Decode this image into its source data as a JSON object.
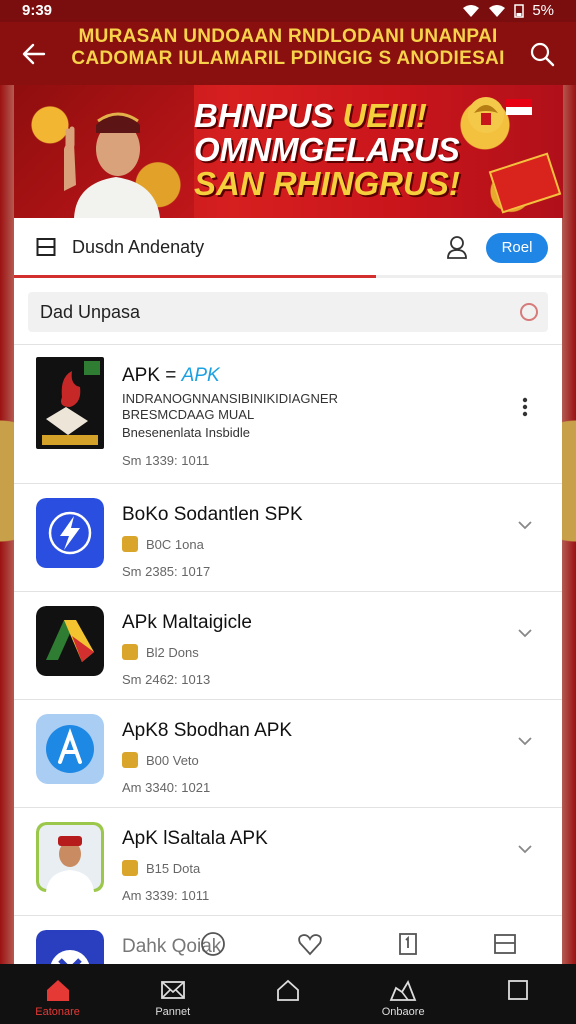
{
  "status_bar": {
    "time": "9:39",
    "battery": "5%",
    "icons": [
      "wifi-icon",
      "signal-icon",
      "battery-icon"
    ]
  },
  "app_bar": {
    "title_line1": "MURASAN UNDOAAN RNDLODANI UNANPAI",
    "title_line2": "CADOMAR IULAMARIL PDINGIG S ANODIESAI",
    "back_icon": "back-arrow-icon",
    "search_icon": "search-icon"
  },
  "banner": {
    "line1_white": "BHNPUS ",
    "line1_yellow": "UEIII!",
    "line2": "OMNMGELARUS",
    "line3": "SAN RHINGRUS!"
  },
  "toolbar": {
    "label": "Dusdn Andenaty",
    "button": "Roel",
    "progress_fraction": 0.66
  },
  "search": {
    "value": "Dad Unpasa"
  },
  "apps": [
    {
      "name_prefix": "APK = ",
      "name_accent": "APK",
      "desc1": "INDRANOGNNANSIBINIKIDIAGNER",
      "desc2": "BRESMCDAAG MUAL",
      "desc3": "Bnesenenlata Insbidle",
      "meta": "Sm 1339: 1011",
      "action": "kebab"
    },
    {
      "name": "BoKo Sodantlen SPK",
      "rating": "B0C 1ona",
      "meta": "Sm 2385: 1017",
      "action": "chevron"
    },
    {
      "name": "APk Maltaigicle",
      "rating": "Bl2 Dons",
      "meta": "Sm 2462: 1013",
      "action": "chevron"
    },
    {
      "name": "ApK8 Sbodhan APK",
      "rating": "B00 Veto",
      "meta": "Am 3340: 1021",
      "action": "chevron"
    },
    {
      "name": "ApK lSaltala APK",
      "rating": "B15 Dota",
      "meta": "Am 3339: 1011",
      "action": "chevron"
    },
    {
      "name": "Dahk Qoiak",
      "partial": true
    }
  ],
  "bottom_nav": [
    {
      "label": "Eatonare",
      "icon": "home-icon",
      "active": true
    },
    {
      "label": "Pannet",
      "icon": "envelope-icon",
      "active": false
    },
    {
      "label": "",
      "icon": "house-outline-icon",
      "active": false
    },
    {
      "label": "Onbaore",
      "icon": "share-icon",
      "active": false
    },
    {
      "label": "",
      "icon": "square-icon",
      "active": false
    }
  ],
  "colors": {
    "appbar": "#8a1010",
    "title_yellow": "#f6d34a",
    "accent_blue": "#1f86e6",
    "active_red": "#e53935"
  }
}
